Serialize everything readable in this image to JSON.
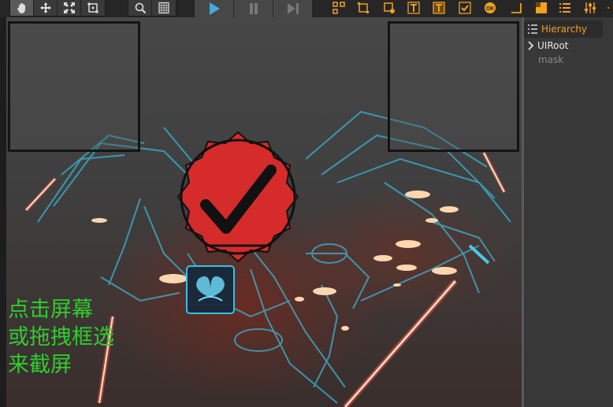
{
  "toolbar": {
    "tools": [
      "hand-tool",
      "move-tool",
      "scale-tool",
      "rect-tool"
    ],
    "view_tools": [
      "zoom-tool",
      "grid-tool"
    ],
    "playback": [
      "play",
      "pause",
      "step"
    ],
    "objects": [
      "widget-icon",
      "sprite-icon",
      "sprite-alt-icon",
      "label-icon",
      "label-frame-icon",
      "toggle-icon",
      "ok-button-icon",
      "anchor-icon",
      "panel-icon",
      "list-icon",
      "slider-icon"
    ]
  },
  "scene": {
    "overlay_text": [
      "点击屏幕",
      "或拖拽框选",
      "来截屏"
    ],
    "overlay_color": "#2fcc2f",
    "stamp_color": "#d52b2b"
  },
  "hierarchy": {
    "tab_label": "Hierarchy",
    "root": "UIRoot",
    "child": "mask",
    "accent": "#f0a020"
  }
}
